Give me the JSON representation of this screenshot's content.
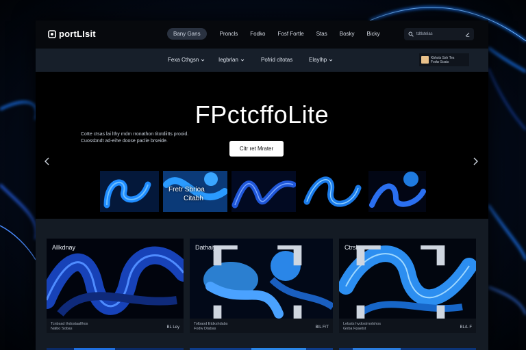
{
  "app": {
    "logo_text": "portLIsit",
    "colors": {
      "accent": "#1e6fe0",
      "glow": "#2a8cff",
      "background": "#030814"
    }
  },
  "nav": {
    "items": [
      {
        "label": "Bany Gans",
        "active": true
      },
      {
        "label": "Proncls"
      },
      {
        "label": "Fodko"
      },
      {
        "label": "Fosf Fortle"
      },
      {
        "label": "Stas"
      },
      {
        "label": "Bosky"
      },
      {
        "label": "Bicky"
      }
    ]
  },
  "search": {
    "placeholder": "tdtlstelas"
  },
  "subnav": {
    "dropdowns": [
      {
        "label": "Fexa Cthgsn"
      },
      {
        "label": "Iegbrlan"
      },
      {
        "label": "Pofrid cltotas"
      },
      {
        "label": "Elaylhp"
      }
    ],
    "profile": {
      "line1": "Kbhsts Ssh Tes",
      "line2": "Fodw Soats"
    }
  },
  "hero": {
    "title": "FPctcffoLite",
    "description_line1": "Cotte ctsas lai lthy mdm rronathon titotdiitts prooid.",
    "description_line2": "Cuossbndt ad-eihe doose paclie brseide.",
    "cta_label": "Citr ret Mrater",
    "prev_icon": "chevron-left-icon",
    "next_icon": "chevron-right-icon",
    "thumbnails": [
      {
        "caption_line1": "",
        "caption_line2": ""
      },
      {
        "caption_line1": "Fretr Sbrioa",
        "caption_line2": "Citabh"
      },
      {
        "caption_line1": "",
        "caption_line2": ""
      },
      {
        "caption_line1": "",
        "caption_line2": ""
      },
      {
        "caption_line1": "",
        "caption_line2": ""
      }
    ]
  },
  "gallery": {
    "cards": [
      {
        "title": "Allkdnay",
        "meta_line1": "Tcnbsad thdostaallhos",
        "meta_line2": "Nalbo Sobas",
        "count": "BL Ley"
      },
      {
        "title": "Dathaiy",
        "meta_line1": "Tolbaod Etdxshdabs",
        "meta_line2": "Fodw Dtabas",
        "count": "BIL F/T"
      },
      {
        "title": "Ctrshom",
        "meta_line1": "Lebats hvdostrnolshos",
        "meta_line2": "Gnba Fpaetst",
        "count": "BL/L F"
      }
    ]
  }
}
